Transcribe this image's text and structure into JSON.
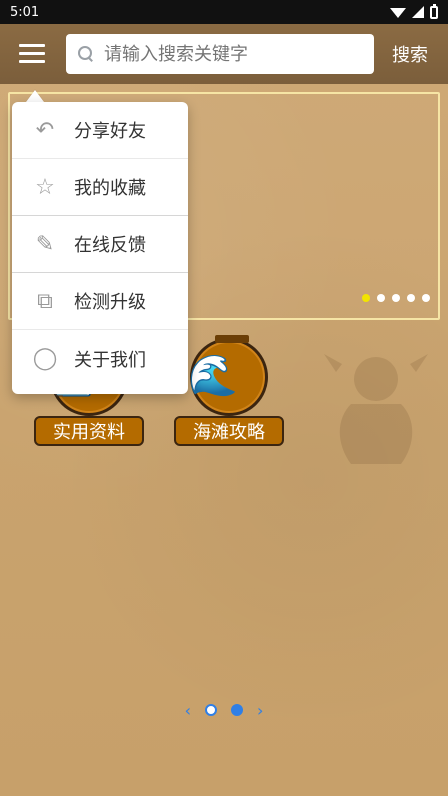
{
  "status_bar": {
    "time": "5:01"
  },
  "header": {
    "search_placeholder": "请输入搜索关键字",
    "search_label": "搜索"
  },
  "banner": {
    "dots": 5,
    "active_index": 0
  },
  "categories": [
    {
      "label": "实用资料",
      "icon": "book-icon"
    },
    {
      "label": "海滩攻略",
      "icon": "wave-icon"
    }
  ],
  "page_indicator": {
    "pages": 2,
    "active_index": 1
  },
  "popup_menu": {
    "items": [
      {
        "label": "分享好友",
        "icon": "share-reply-icon"
      },
      {
        "label": "我的收藏",
        "icon": "star-icon"
      },
      {
        "label": "在线反馈",
        "icon": "pencil-icon"
      },
      {
        "label": "检测升级",
        "icon": "external-link-icon"
      },
      {
        "label": "关于我们",
        "icon": "user-circle-icon"
      }
    ]
  },
  "colors": {
    "header_bg": "#7b5e3b",
    "accent_orange": "#b46b00",
    "banner_border": "#f6e5a5",
    "indicator_blue": "#2f7fe6",
    "active_dot_yellow": "#f2e400"
  }
}
